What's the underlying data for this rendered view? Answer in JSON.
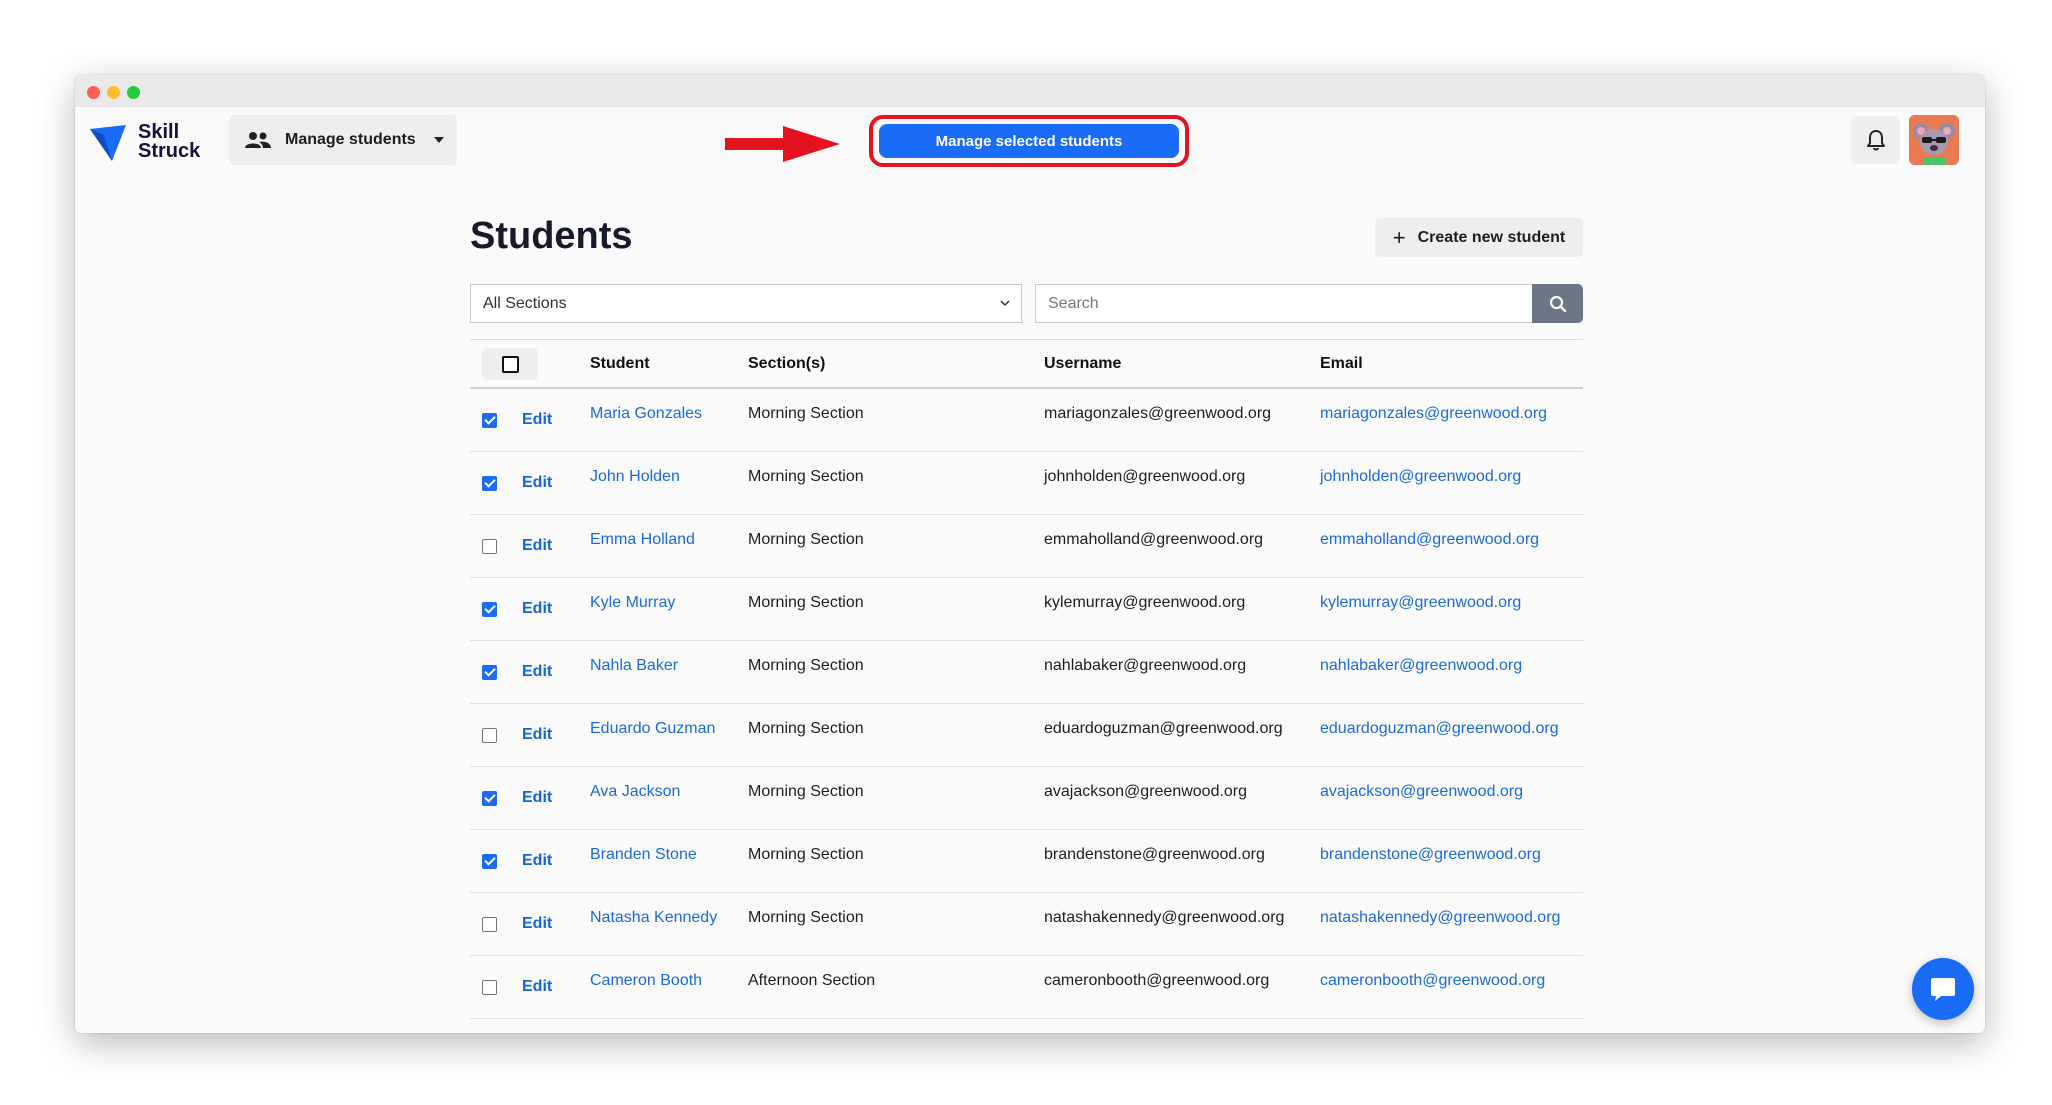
{
  "app": {
    "logo_line1": "Skill",
    "logo_line2": "Struck",
    "brand_color": "#1a6bf5"
  },
  "header": {
    "manage_students_label": "Manage students",
    "manage_selected_label": "Manage selected students",
    "highlight_color": "#e3131f"
  },
  "page": {
    "title": "Students",
    "create_label": "Create new student"
  },
  "filters": {
    "section_value": "All Sections",
    "search_placeholder": "Search"
  },
  "table": {
    "columns": [
      "Student",
      "Section(s)",
      "Username",
      "Email"
    ],
    "edit_label": "Edit",
    "rows": [
      {
        "checked": true,
        "name": "Maria Gonzales",
        "section": "Morning Section",
        "username": "mariagonzales@greenwood.org",
        "email": "mariagonzales@greenwood.org"
      },
      {
        "checked": true,
        "name": "John Holden",
        "section": "Morning Section",
        "username": "johnholden@greenwood.org",
        "email": "johnholden@greenwood.org"
      },
      {
        "checked": false,
        "name": "Emma Holland",
        "section": "Morning Section",
        "username": "emmaholland@greenwood.org",
        "email": "emmaholland@greenwood.org"
      },
      {
        "checked": true,
        "name": "Kyle Murray",
        "section": "Morning Section",
        "username": "kylemurray@greenwood.org",
        "email": "kylemurray@greenwood.org"
      },
      {
        "checked": true,
        "name": "Nahla Baker",
        "section": "Morning Section",
        "username": "nahlabaker@greenwood.org",
        "email": "nahlabaker@greenwood.org"
      },
      {
        "checked": false,
        "name": "Eduardo Guzman",
        "section": "Morning Section",
        "username": "eduardoguzman@greenwood.org",
        "email": "eduardoguzman@greenwood.org"
      },
      {
        "checked": true,
        "name": "Ava Jackson",
        "section": "Morning Section",
        "username": "avajackson@greenwood.org",
        "email": "avajackson@greenwood.org"
      },
      {
        "checked": true,
        "name": "Branden Stone",
        "section": "Morning Section",
        "username": "brandenstone@greenwood.org",
        "email": "brandenstone@greenwood.org"
      },
      {
        "checked": false,
        "name": "Natasha Kennedy",
        "section": "Morning Section",
        "username": "natashakennedy@greenwood.org",
        "email": "natashakennedy@greenwood.org"
      },
      {
        "checked": false,
        "name": "Cameron Booth",
        "section": "Afternoon Section",
        "username": "cameronbooth@greenwood.org",
        "email": "cameronbooth@greenwood.org"
      }
    ]
  },
  "icons": {
    "people": "people-icon",
    "bell": "bell-icon",
    "search": "search-icon",
    "chat": "chat-icon",
    "plus": "plus-icon"
  }
}
